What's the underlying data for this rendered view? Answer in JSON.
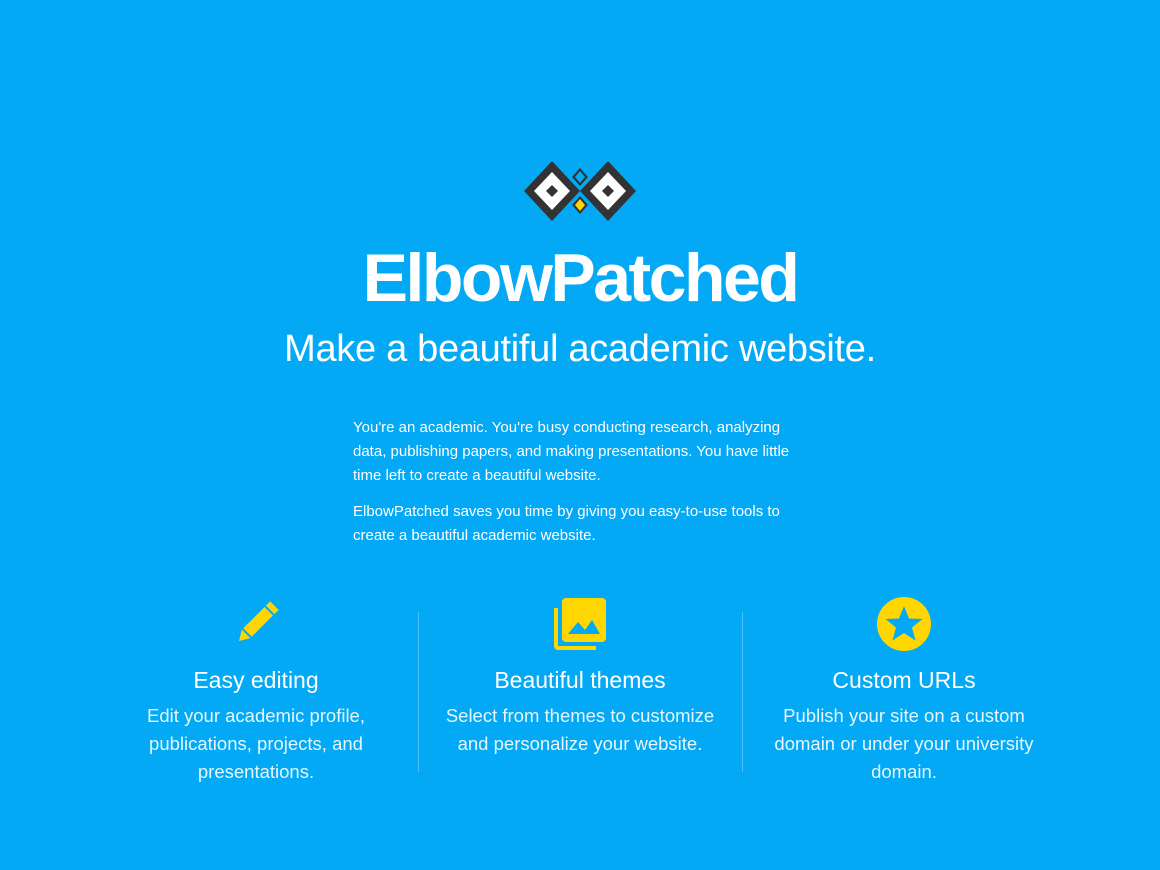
{
  "brand": {
    "name": "ElbowPatched",
    "tagline": "Make a beautiful academic website.",
    "logo_icon": "diamond-patch-logo-icon"
  },
  "intro": {
    "paragraph_1": "You're an academic. You're busy conducting research, analyzing data, publishing papers, and making presentations. You have little time left to create a beautiful website.",
    "paragraph_2": "ElbowPatched saves you time by giving you easy-to-use tools to create a beautiful academic website."
  },
  "features": [
    {
      "icon": "pencil-icon",
      "title": "Easy editing",
      "description": "Edit your academic profile, publications, projects, and presentations."
    },
    {
      "icon": "photo-library-icon",
      "title": "Beautiful themes",
      "description": "Select from themes to customize and personalize your website."
    },
    {
      "icon": "star-circle-icon",
      "title": "Custom URLs",
      "description": "Publish your site on a custom domain or under your university domain."
    }
  ],
  "colors": {
    "background": "#03a9f4",
    "accent": "#ffd600",
    "logo_dark": "#333333",
    "text": "#ffffff"
  }
}
